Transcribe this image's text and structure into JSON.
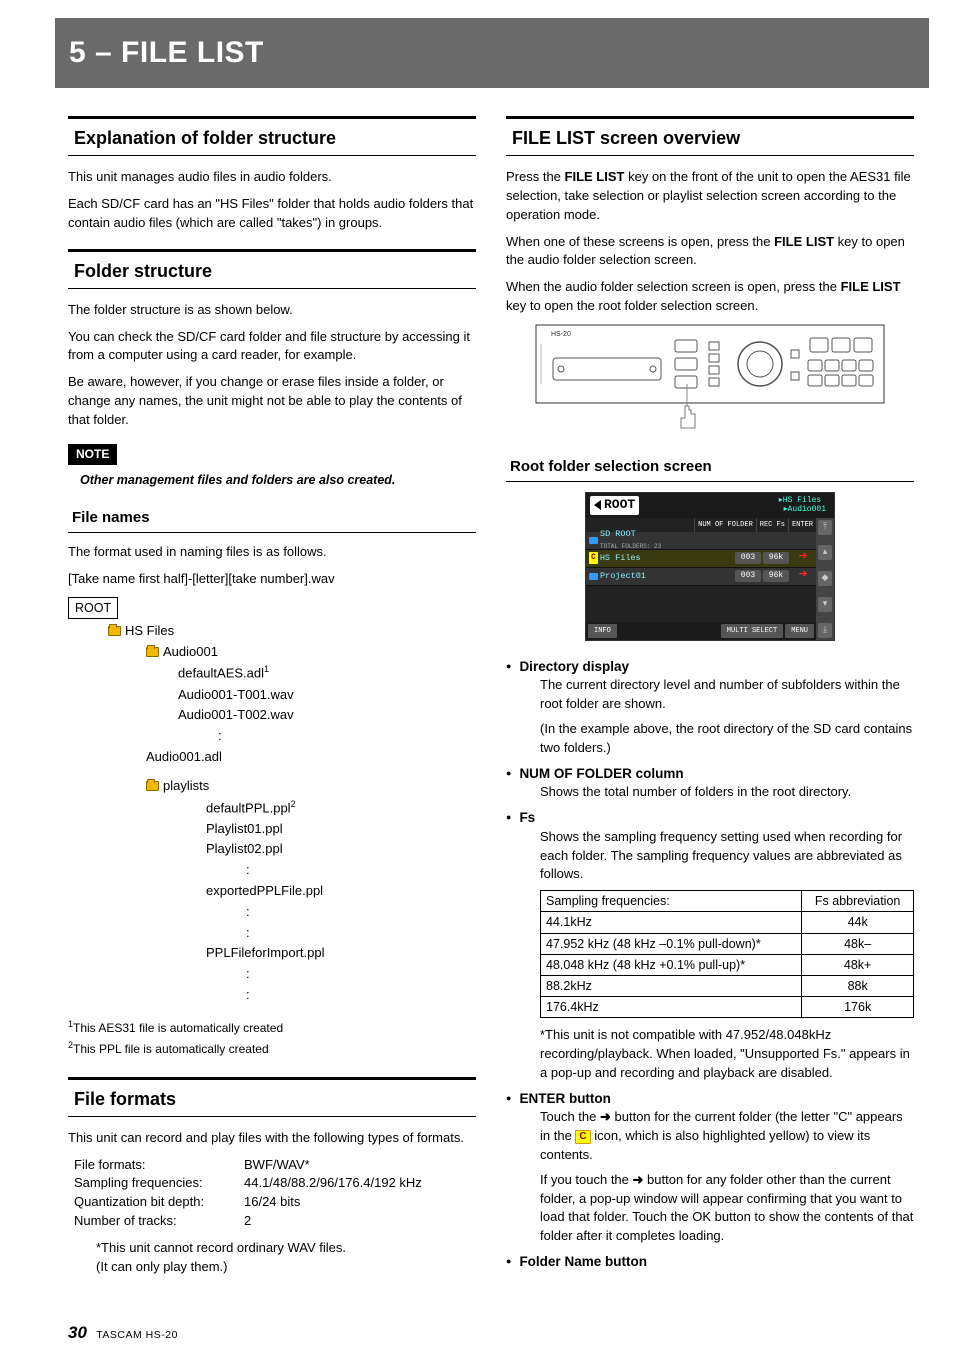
{
  "chapter_title": "5 – FILE LIST",
  "left": {
    "sec1_title": "Explanation of folder structure",
    "sec1_p1": "This unit manages audio files in audio folders.",
    "sec1_p2": "Each SD/CF card has an \"HS Files\" folder that holds audio folders that contain audio files (which are called \"takes\") in groups.",
    "sec2_title": "Folder structure",
    "sec2_p1": "The folder structure is as shown below.",
    "sec2_p2": "You can check the SD/CF card folder and file structure by accessing it from a computer using a card reader, for example.",
    "sec2_p3": "Be aware, however, if you change or erase files inside a folder, or change any names, the unit might not be able to play the contents of that folder.",
    "note_label": "NOTE",
    "note_text": "Other management files and folders are also created.",
    "sub_file_names": "File names",
    "fn_p1": "The format used in naming files is as follows.",
    "fn_p2": "[Take name first half]-[letter][take number].wav",
    "tree": {
      "root": "ROOT",
      "hs_files": "HS Files",
      "audio001": "Audio001",
      "defaultAES": "defaultAES.adl",
      "t001": "Audio001-T001.wav",
      "t002": "Audio001-T002.wav",
      "audio001adl": "Audio001.adl",
      "playlists": "playlists",
      "defaultPPL": "defaultPPL.ppl",
      "pl01": "Playlist01.ppl",
      "pl02": "Playlist02.ppl",
      "exported": "exportedPPLFile.ppl",
      "import": "PPLFileforImport.ppl"
    },
    "foot1": "This AES31 file is automatically created",
    "foot2": "This PPL file is automatically created",
    "sec3_title": "File formats",
    "ff_p1": "This unit can record and play files with the following types of formats.",
    "spec": {
      "k1": "File formats:",
      "v1": "BWF/WAV*",
      "k2": "Sampling frequencies:",
      "v2": "44.1/48/88.2/96/176.4/192 kHz",
      "k3": "Quantization bit depth:",
      "v3": "16/24 bits",
      "k4": "Number of tracks:",
      "v4": "2"
    },
    "ff_note1": "*This unit cannot record ordinary WAV files.",
    "ff_note2": "(It can only play them.)"
  },
  "right": {
    "sec1_title": "FILE LIST screen overview",
    "p1a": "Press the ",
    "p1b": "FILE LIST",
    "p1c": " key on the front of the unit to open the AES31 file selection, take selection or playlist selection screen according to the operation mode.",
    "p2a": "When one of these screens is open, press the ",
    "p2b": "FILE LIST",
    "p2c": " key to open the audio folder selection screen.",
    "p3a": "When the audio folder selection screen is open, press the ",
    "p3b": "FILE LIST",
    "p3c": " key to open the root folder selection screen.",
    "sub_root": "Root folder selection screen",
    "ss": {
      "root": "ROOT",
      "path1": "HS Files",
      "path2": "Audio001",
      "h1": "NUM OF FOLDER",
      "h2": "REC Fs",
      "h3": "ENTER",
      "r1_name": "SD ROOT",
      "r1_sub": "TOTAL FOLDERS: 23",
      "r2_name": "HS Files",
      "r2_c1": "003",
      "r2_c2": "96k",
      "r3_name": "Project01",
      "r3_c1": "003",
      "r3_c2": "96k",
      "info": "INFO",
      "multi": "MULTI SELECT",
      "menu": "MENU"
    },
    "b1_head": "Directory display",
    "b1_p1": "The current directory level and number of subfolders within the root folder are shown.",
    "b1_p2": "(In the example above, the root directory of the SD card contains two folders.)",
    "b2_head": "NUM OF FOLDER column",
    "b2_p1": "Shows the total number of folders in the root directory.",
    "b3_head": "Fs",
    "b3_p1": "Shows the sampling frequency setting used when recording for each folder. The sampling frequency values are abbreviated as follows.",
    "table": {
      "h1": "Sampling frequencies:",
      "h2": "Fs abbreviation",
      "r1a": "44.1kHz",
      "r1b": "44k",
      "r2a": "47.952 kHz (48 kHz –0.1% pull-down)*",
      "r2b": "48k–",
      "r3a": "48.048 kHz (48 kHz +0.1% pull-up)*",
      "r3b": "48k+",
      "r4a": "88.2kHz",
      "r4b": "88k",
      "r5a": "176.4kHz",
      "r5b": "176k"
    },
    "b3_note": "*This unit is not compatible with 47.952/48.048kHz recording/playback. When loaded, \"Unsupported Fs.\" appears in a pop-up and recording and playback are disabled.",
    "b4_head": "ENTER button",
    "b4_p1a": "Touch the ",
    "b4_p1b": " button for the current folder (the letter \"C\" appears in the ",
    "b4_p1c": " icon, which is also highlighted yellow) to view its contents.",
    "b4_p2a": "If you touch the ",
    "b4_p2b": " button for any folder other than the current folder, a pop-up window will appear confirming that you want to load that folder. Touch the OK button to show the contents of that folder after it completes loading.",
    "b5_head": "Folder Name button"
  },
  "footer": {
    "page": "30",
    "model": "TASCAM HS-20"
  }
}
